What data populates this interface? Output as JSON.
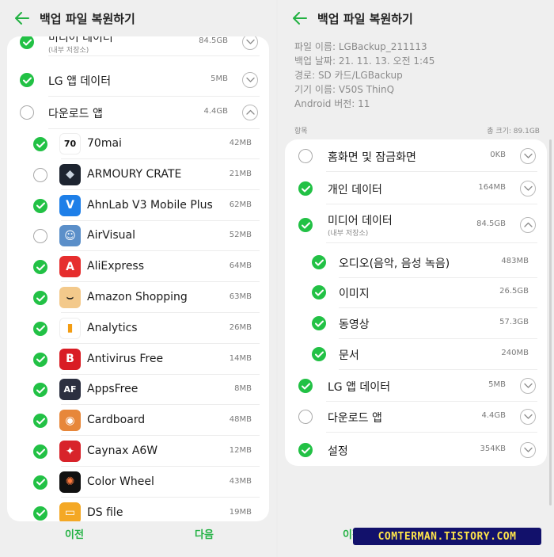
{
  "left": {
    "title": "백업 파일 복원하기",
    "top_items": [
      {
        "label": "미디어 데이터",
        "sublabel": "(내부 저장소)",
        "size": "84.5GB",
        "checked": true,
        "expand": "down"
      },
      {
        "label": "LG 앱 데이터",
        "size": "5MB",
        "checked": true,
        "expand": "down"
      },
      {
        "label": "다운로드 앱",
        "size": "4.4GB",
        "checked": false,
        "expand": "up"
      }
    ],
    "apps": [
      {
        "label": "70mai",
        "size": "42MB",
        "checked": true,
        "icon": "70mai-icon",
        "icon_text": "70",
        "bg": "#ffffff",
        "fg": "#111111"
      },
      {
        "label": "ARMOURY CRATE",
        "size": "21MB",
        "checked": false,
        "icon": "armoury-crate-icon",
        "icon_text": "◆",
        "bg": "#1d2430",
        "fg": "#c9d3de"
      },
      {
        "label": "AhnLab V3 Mobile Plus",
        "size": "62MB",
        "checked": true,
        "icon": "ahnlab-v3-icon",
        "icon_text": "V",
        "bg": "#1e7fe8",
        "fg": "#ffffff"
      },
      {
        "label": "AirVisual",
        "size": "52MB",
        "checked": false,
        "icon": "airvisual-icon",
        "icon_text": "☺",
        "bg": "#5b8fc9",
        "fg": "#ffffff"
      },
      {
        "label": "AliExpress",
        "size": "64MB",
        "checked": true,
        "icon": "aliexpress-icon",
        "icon_text": "A",
        "bg": "#e62e2e",
        "fg": "#ffffff"
      },
      {
        "label": "Amazon Shopping",
        "size": "63MB",
        "checked": true,
        "icon": "amazon-shopping-icon",
        "icon_text": "⌣",
        "bg": "#f3c98b",
        "fg": "#1b1b1b"
      },
      {
        "label": "Analytics",
        "size": "26MB",
        "checked": true,
        "icon": "analytics-icon",
        "icon_text": "▮",
        "bg": "#ffffff",
        "fg": "#f39c12"
      },
      {
        "label": "Antivirus Free",
        "size": "14MB",
        "checked": true,
        "icon": "antivirus-free-icon",
        "icon_text": "B",
        "bg": "#d91c24",
        "fg": "#ffffff"
      },
      {
        "label": "AppsFree",
        "size": "8MB",
        "checked": true,
        "icon": "appsfree-icon",
        "icon_text": "AF",
        "bg": "#2c3040",
        "fg": "#ffffff"
      },
      {
        "label": "Cardboard",
        "size": "48MB",
        "checked": true,
        "icon": "cardboard-icon",
        "icon_text": "◉",
        "bg": "#e7873a",
        "fg": "#ffffff"
      },
      {
        "label": "Caynax A6W",
        "size": "12MB",
        "checked": true,
        "icon": "caynax-icon",
        "icon_text": "✦",
        "bg": "#d8232a",
        "fg": "#ffffff"
      },
      {
        "label": "Color Wheel",
        "size": "43MB",
        "checked": true,
        "icon": "color-wheel-icon",
        "icon_text": "✺",
        "bg": "#111111",
        "fg": "#ff7a3d"
      },
      {
        "label": "DS file",
        "size": "19MB",
        "checked": true,
        "icon": "ds-file-icon",
        "icon_text": "▭",
        "bg": "#f4a825",
        "fg": "#ffffff"
      }
    ],
    "prev_label": "이전",
    "next_label": "다음"
  },
  "right": {
    "title": "백업 파일 복원하기",
    "info": [
      "파일 이름: LGBackup_211113",
      "백업 날짜: 21. 11. 13. 오전 1:45",
      "경로: SD 카드/LGBackup",
      "기기 이름: V50S ThinQ",
      "Android 버전: 11"
    ],
    "section_label": "항목",
    "total_label": "총 크기: 89.1GB",
    "items": [
      {
        "label": "홈화면 및 잠금화면",
        "size": "0KB",
        "checked": false,
        "expand": "down",
        "sub": false
      },
      {
        "label": "개인 데이터",
        "size": "164MB",
        "checked": true,
        "expand": "down",
        "sub": false
      },
      {
        "label": "미디어 데이터",
        "sublabel": "(내부 저장소)",
        "size": "84.5GB",
        "checked": true,
        "expand": "up",
        "sub": false
      },
      {
        "label": "오디오(음악, 음성 녹음)",
        "size": "483MB",
        "checked": true,
        "sub": true
      },
      {
        "label": "이미지",
        "size": "26.5GB",
        "checked": true,
        "sub": true
      },
      {
        "label": "동영상",
        "size": "57.3GB",
        "checked": true,
        "sub": true
      },
      {
        "label": "문서",
        "size": "240MB",
        "checked": true,
        "sub": true
      },
      {
        "label": "LG 앱 데이터",
        "size": "5MB",
        "checked": true,
        "expand": "down",
        "sub": false
      },
      {
        "label": "다운로드 앱",
        "size": "4.4GB",
        "checked": false,
        "expand": "down",
        "sub": false
      },
      {
        "label": "설정",
        "size": "354KB",
        "checked": true,
        "expand": "down",
        "sub": false
      }
    ],
    "prev_label": "이전"
  },
  "watermark": "COMTERMAN.TISTORY.COM",
  "colors": {
    "accent": "#22c145",
    "watermark_bg": "#12116b",
    "watermark_fg": "#ffe54a"
  }
}
